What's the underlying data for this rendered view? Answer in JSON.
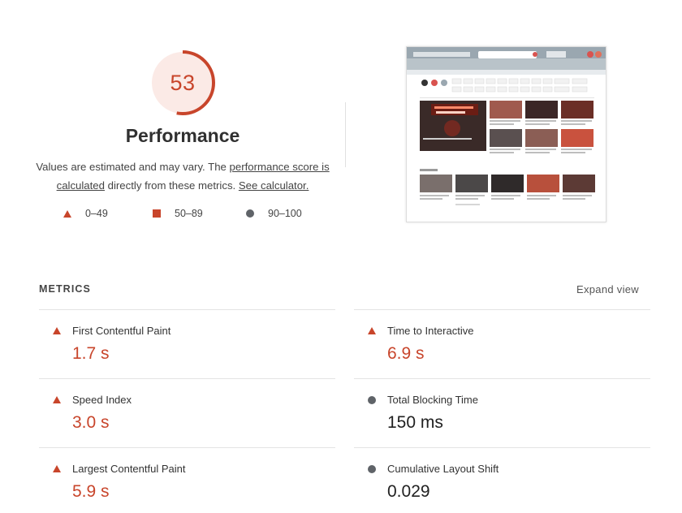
{
  "score": {
    "value": "53",
    "fraction": 0.53,
    "color": "#c8452b",
    "title": "Performance",
    "desc_prefix": "Values are estimated and may vary. The ",
    "desc_link1": "performance score is calculated",
    "desc_middle": " directly from these metrics. ",
    "desc_link2": "See calculator."
  },
  "legend": [
    {
      "icon": "triangle-icon",
      "label": "0–49"
    },
    {
      "icon": "square-icon",
      "label": "50–89"
    },
    {
      "icon": "circle-icon",
      "label": "90–100"
    }
  ],
  "metrics": {
    "title": "METRICS",
    "expand_label": "Expand view",
    "left": [
      {
        "label": "First Contentful Paint",
        "value": "1.7 s",
        "status": "fail"
      },
      {
        "label": "Speed Index",
        "value": "3.0 s",
        "status": "fail"
      },
      {
        "label": "Largest Contentful Paint",
        "value": "5.9 s",
        "status": "fail"
      }
    ],
    "right": [
      {
        "label": "Time to Interactive",
        "value": "6.9 s",
        "status": "fail"
      },
      {
        "label": "Total Blocking Time",
        "value": "150 ms",
        "status": "pass"
      },
      {
        "label": "Cumulative Layout Shift",
        "value": "0.029",
        "status": "pass"
      }
    ]
  },
  "colors": {
    "fail": "#c8452b",
    "pass": "#5f6368"
  }
}
